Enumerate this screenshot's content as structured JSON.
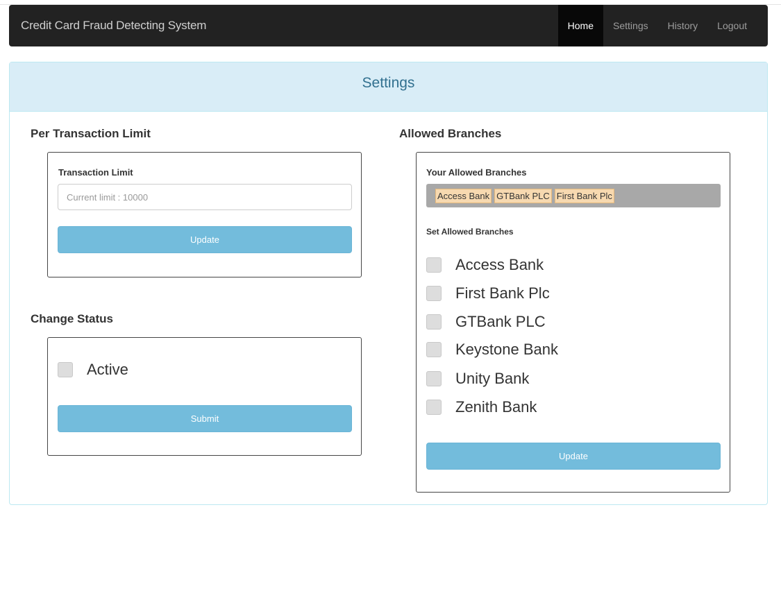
{
  "navbar": {
    "brand": "Credit Card Fraud Detecting System",
    "items": [
      {
        "label": "Home",
        "active": true
      },
      {
        "label": "Settings",
        "active": false
      },
      {
        "label": "History",
        "active": false
      },
      {
        "label": "Logout",
        "active": false
      }
    ]
  },
  "panel": {
    "title": "Settings"
  },
  "transaction_limit": {
    "section_title": "Per Transaction Limit",
    "field_label": "Transaction Limit",
    "input_value": "",
    "input_placeholder": "Current limit : 10000",
    "button_label": "Update"
  },
  "change_status": {
    "section_title": "Change Status",
    "checkbox_label": "Active",
    "checked": false,
    "button_label": "Submit"
  },
  "allowed_branches": {
    "section_title": "Allowed Branches",
    "current_label": "Your Allowed Branches",
    "current_tags": [
      "Access Bank",
      "GTBank PLC",
      "First Bank Plc"
    ],
    "set_label": "Set Allowed Branches",
    "options": [
      {
        "label": "Access Bank",
        "checked": false
      },
      {
        "label": "First Bank Plc",
        "checked": false
      },
      {
        "label": "GTBank PLC",
        "checked": false
      },
      {
        "label": "Keystone Bank",
        "checked": false
      },
      {
        "label": "Unity Bank",
        "checked": false
      },
      {
        "label": "Zenith Bank",
        "checked": false
      }
    ],
    "button_label": "Update"
  },
  "colors": {
    "navbar_bg": "#222222",
    "panel_heading_bg": "#d9edf7",
    "panel_heading_text": "#31708f",
    "button_bg": "#73bcdc",
    "tag_bg": "#f7d9b0",
    "tags_box_bg": "#a8a8a8"
  }
}
